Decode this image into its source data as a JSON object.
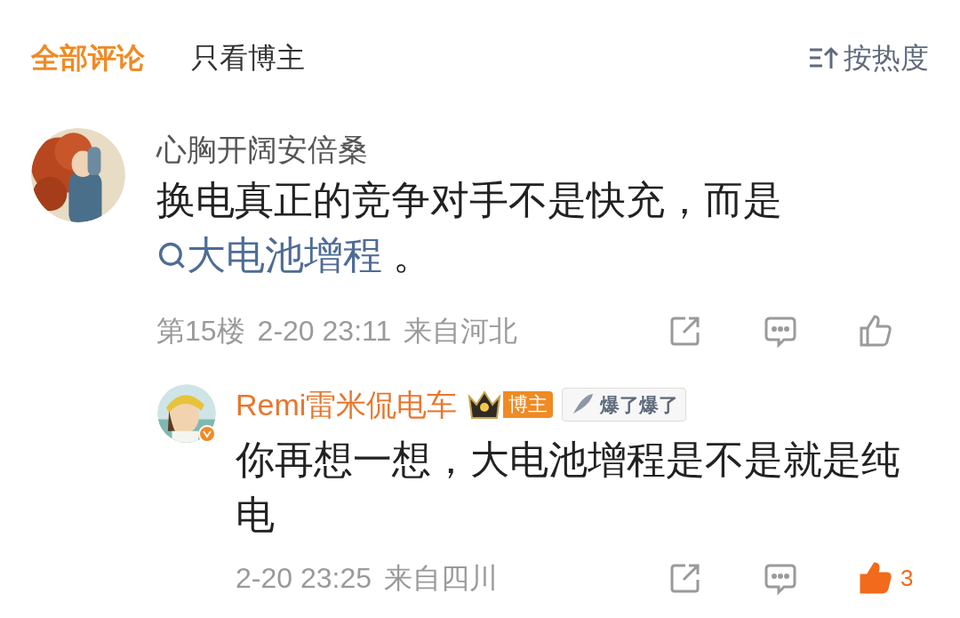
{
  "tabs": [
    {
      "label": "全部评论",
      "selected": true
    },
    {
      "label": "只看博主",
      "selected": false
    }
  ],
  "sort": {
    "label": "按热度"
  },
  "comment": {
    "author": "心胸开阔安倍桑",
    "segments": [
      {
        "kind": "text",
        "text": "换电真正的竞争对手不是快充，而是"
      },
      {
        "kind": "topic",
        "text": "大电池增程"
      },
      {
        "kind": "text",
        "text": " 。"
      }
    ],
    "floor": "第15楼",
    "time": "2-20 23:11",
    "location": "来自河北",
    "liked": false
  },
  "reply": {
    "author": "Remi雷米侃电车",
    "verified": true,
    "badges": [
      {
        "kind": "crown",
        "text": "博主"
      },
      {
        "kind": "tag",
        "text": "爆了爆了"
      }
    ],
    "text": "你再想一想，大电池增程是不是就是纯电",
    "time": "2-20 23:25",
    "location": "来自四川",
    "liked": true,
    "like_count": "3"
  }
}
